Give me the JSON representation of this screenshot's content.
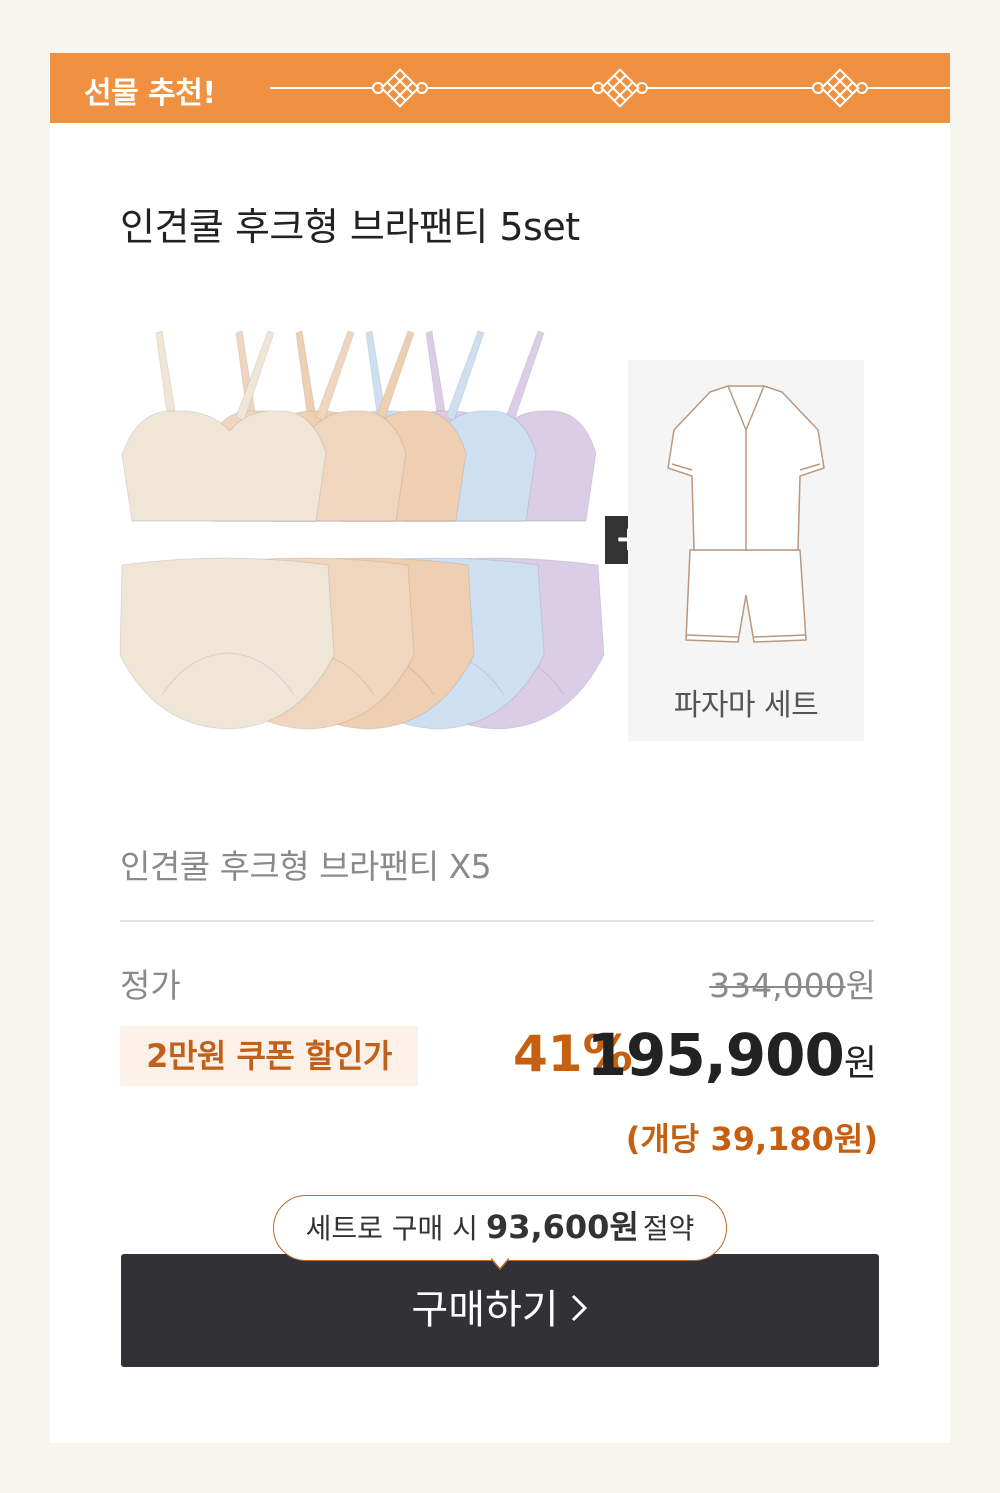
{
  "banner": {
    "title": "선물 추천!",
    "color": "#ef9140"
  },
  "product": {
    "title": "인견쿨 후크형 브라팬티 5set"
  },
  "bundle": {
    "plus_symbol": "+",
    "colors": [
      "#efe6d8",
      "#f1d6bf",
      "#efcfb1",
      "#cfdff2",
      "#dccde6"
    ],
    "addon_label": "파자마 세트"
  },
  "items_line": "인견쿨 후크형 브라팬티 X5",
  "price": {
    "list_label": "정가",
    "list_value": "334,000",
    "currency": "원",
    "coupon_label": "2만원 쿠폰 할인가",
    "discount": "41%",
    "sale_value": "195,900",
    "per_unit": "(개당 39,180원)"
  },
  "cta": {
    "savings_prefix": "세트로 구매 시",
    "savings_amount": "93,600원",
    "savings_suffix": "절약",
    "button_label": "구매하기",
    "button_icon": "chevron-right-icon"
  }
}
